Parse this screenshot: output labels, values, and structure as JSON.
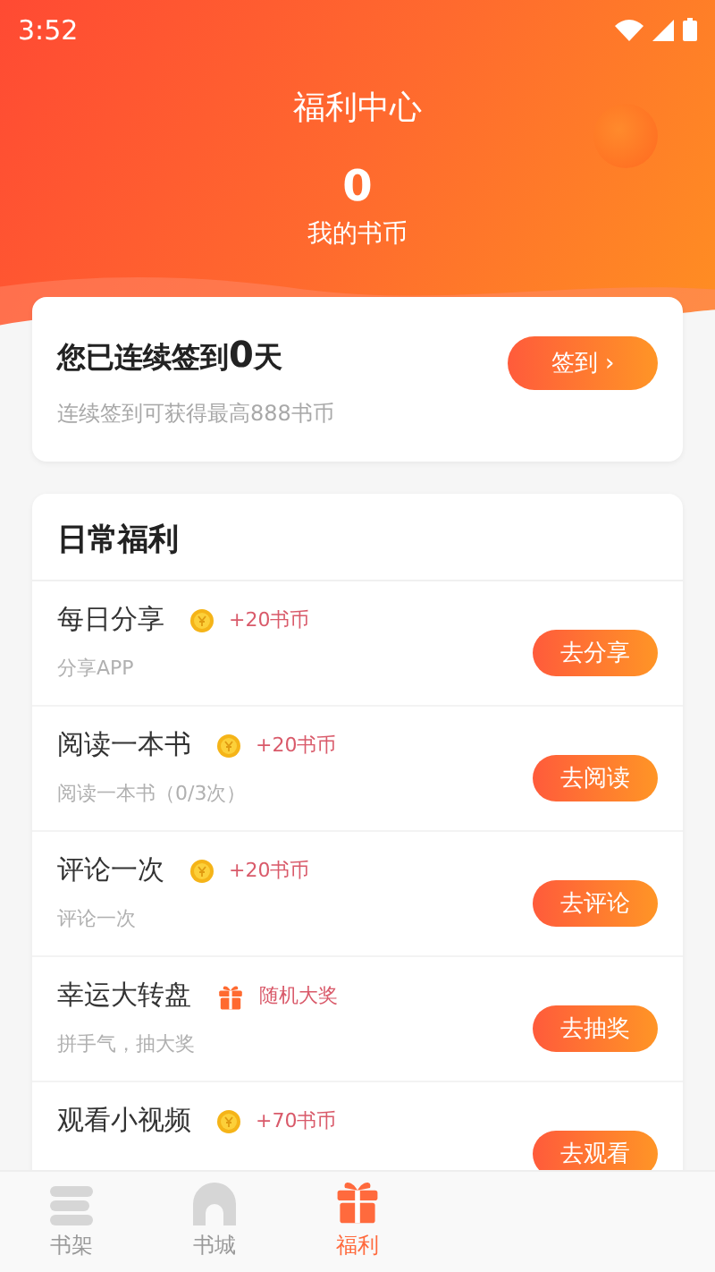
{
  "status_bar": {
    "time": "3:52"
  },
  "header": {
    "title": "福利中心",
    "coins": "0",
    "coins_label": "我的书币"
  },
  "checkin": {
    "text": "您已连续签到**0**天",
    "subtitle": "连续签到可获得最高888书币",
    "button": "签到 ›"
  },
  "daily": {
    "title": "日常福利",
    "tasks": [
      {
        "title": "每日分享",
        "kind": "coin",
        "reward": "+20书币",
        "subtitle": "分享APP",
        "button": "去分享"
      },
      {
        "title": "阅读一本书",
        "kind": "coin",
        "reward": "+20书币",
        "subtitle": "阅读一本书（0/3次）",
        "button": "去阅读"
      },
      {
        "title": "评论一次",
        "kind": "coin",
        "reward": "+20书币",
        "subtitle": "评论一次",
        "button": "去评论"
      },
      {
        "title": "幸运大转盘",
        "kind": "gift",
        "reward": "随机大奖",
        "subtitle": "拼手气，抽大奖",
        "button": "去抽奖"
      },
      {
        "title": "观看小视频",
        "kind": "coin",
        "reward": "+70书币",
        "button": "去观看"
      }
    ]
  },
  "tab_bar": [
    {
      "label": "书架",
      "kind": "shelf",
      "selected": false
    },
    {
      "label": "书城",
      "kind": "store",
      "selected": false
    },
    {
      "label": "福利",
      "kind": "gift",
      "selected": true
    }
  ]
}
